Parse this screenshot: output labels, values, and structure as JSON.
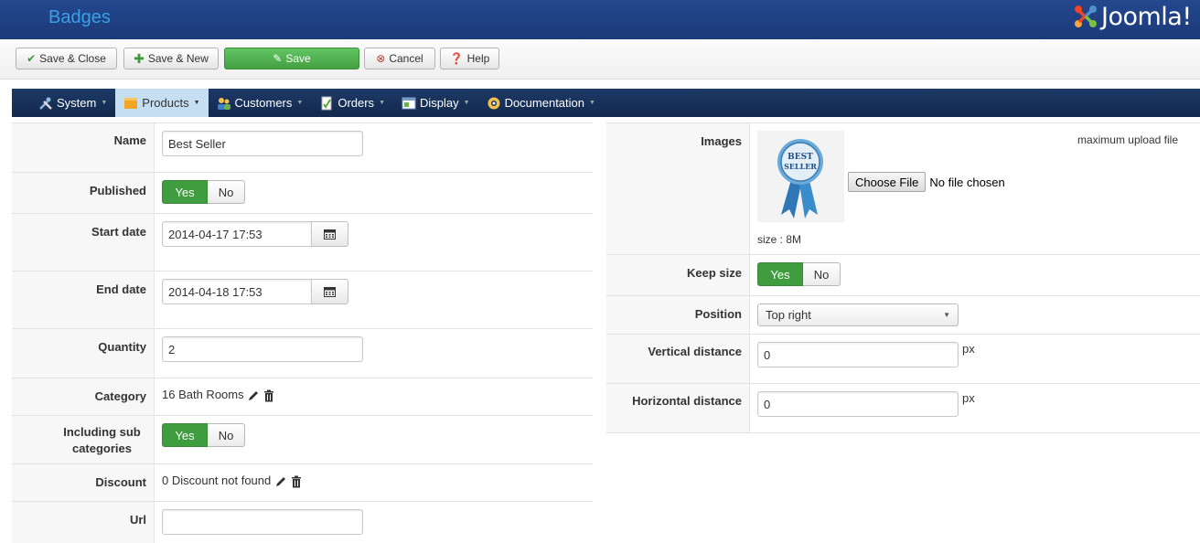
{
  "header": {
    "title": "Badges",
    "logo_text": "Joomla!"
  },
  "toolbar": {
    "save_close": "Save & Close",
    "save_new": "Save & New",
    "save": "Save",
    "cancel": "Cancel",
    "help": "Help"
  },
  "menu": {
    "items": [
      {
        "label": "System",
        "icon": "tools-icon"
      },
      {
        "label": "Products",
        "icon": "box-icon"
      },
      {
        "label": "Customers",
        "icon": "users-icon"
      },
      {
        "label": "Orders",
        "icon": "orders-icon"
      },
      {
        "label": "Display",
        "icon": "display-icon"
      },
      {
        "label": "Documentation",
        "icon": "help-ring-icon"
      }
    ],
    "active": "Products"
  },
  "form_left": {
    "name": {
      "label": "Name",
      "value": "Best Seller"
    },
    "published": {
      "label": "Published",
      "yes": "Yes",
      "no": "No"
    },
    "start_date": {
      "label": "Start date",
      "value": "2014-04-17 17:53"
    },
    "end_date": {
      "label": "End date",
      "value": "2014-04-18 17:53"
    },
    "quantity": {
      "label": "Quantity",
      "value": "2"
    },
    "category": {
      "label": "Category",
      "value": "16 Bath Rooms"
    },
    "including_sub": {
      "label": "Including sub categories",
      "yes": "Yes",
      "no": "No"
    },
    "discount": {
      "label": "Discount",
      "value": "0 Discount not found"
    },
    "url": {
      "label": "Url",
      "value": ""
    }
  },
  "form_right": {
    "images": {
      "label": "Images",
      "badge_text_line1": "BEST",
      "badge_text_line2": "SELLER",
      "choose_file": "Choose File",
      "no_file": "No file chosen",
      "max_upload": "maximum upload file",
      "size": "size : 8M"
    },
    "keep_size": {
      "label": "Keep size",
      "yes": "Yes",
      "no": "No"
    },
    "position": {
      "label": "Position",
      "value": "Top right"
    },
    "vertical": {
      "label": "Vertical distance",
      "value": "0",
      "unit": "px"
    },
    "horizontal": {
      "label": "Horizontal distance",
      "value": "0",
      "unit": "px"
    }
  },
  "colors": {
    "header_bg": "#1f3f7d",
    "menubar_bg": "#1b3561",
    "accent_green": "#3f9d3f",
    "active_menu": "#c6def2",
    "title_blue": "#3aa0e6"
  }
}
